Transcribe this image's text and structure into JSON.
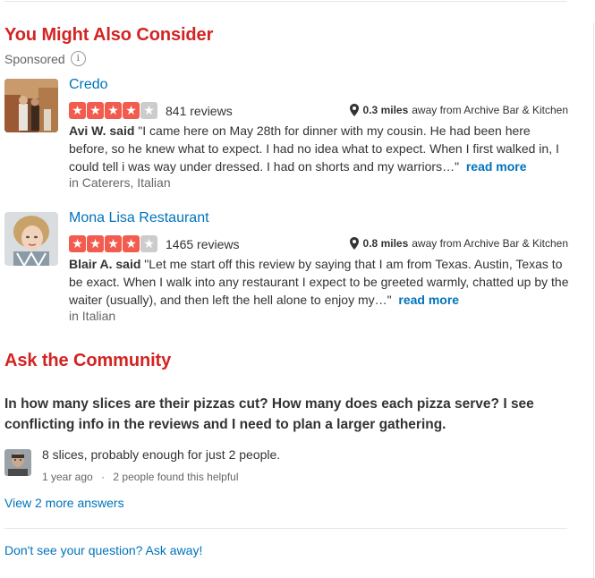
{
  "consider": {
    "title": "You Might Also Consider",
    "sponsored_label": "Sponsored",
    "info_glyph": "i",
    "star_glyph": "★",
    "businesses": [
      {
        "name": "Credo",
        "rating": 4,
        "max_rating": 5,
        "reviews": "841 reviews",
        "distance": "0.3 miles",
        "distance_suffix": "away from Archive Bar & Kitchen",
        "author": "Avi W. said",
        "quote": "\"I came here on May 28th for dinner with my cousin. He had been here before, so he knew what to expect. I had no idea what to expect. When I first walked in, I could tell i was way under dressed. I had on shorts and my warriors…\"",
        "read_more": "read more",
        "categories": "in Caterers, Italian"
      },
      {
        "name": "Mona Lisa Restaurant",
        "rating": 4,
        "max_rating": 5,
        "reviews": "1465 reviews",
        "distance": "0.8 miles",
        "distance_suffix": "away from Archive Bar & Kitchen",
        "author": "Blair A. said",
        "quote": "\"Let me start off this review by saying that I am from Texas. Austin, Texas to be exact. When I walk into any restaurant I expect to be greeted warmly, chatted up by the waiter (usually), and then left the hell alone to enjoy my…\"",
        "read_more": "read more",
        "categories": "in Italian"
      }
    ]
  },
  "community": {
    "title": "Ask the Community",
    "question": "In how many slices are their pizzas cut? How many does each pizza serve? I see conflicting info in the reviews and I need to plan a larger gathering.",
    "answer": "8 slices, probably enough for just 2 people.",
    "answer_age": "1 year ago",
    "meta_separator": "·",
    "answer_helpful": "2 people found this helpful",
    "more_answers": "View 2 more answers",
    "ask_link": "Don't see your question? Ask away!"
  },
  "colors": {
    "accent": "#d32323",
    "link": "#0073bb",
    "star": "#f15c4f",
    "star_empty": "#cccccc"
  },
  "icons": {
    "info": "info-icon",
    "pin": "map-pin-icon",
    "star": "star-icon"
  }
}
